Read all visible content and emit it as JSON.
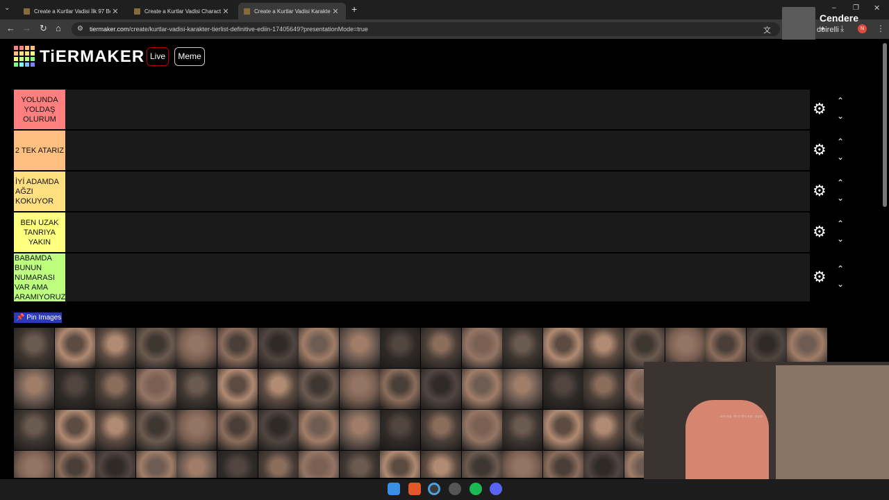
{
  "browser": {
    "tabs": [
      {
        "title": "Create a Kurtlar Vadisi İlk 97 Bö"
      },
      {
        "title": "Create a Kurtlar Vadisi Characte"
      },
      {
        "title": "Create a Kurtlar Vadisi Karakter"
      }
    ],
    "new_tab": "+",
    "url_host": "tiermaker.com",
    "url_path": "/create/kurtlar-vadisi-karakter-tierlist-definitive-ediin-17405649?presentationMode=true",
    "profile_badge": "N",
    "overlay_name": "Cendere",
    "overlay_sub": "doirelli"
  },
  "site": {
    "logo_text": "TiERMAKER",
    "live_button": "Live",
    "meme_button": "Meme"
  },
  "tiers": [
    {
      "label": "YOLUNDA YOLDAŞ OLURUM",
      "color": "#ff7f7f"
    },
    {
      "label": "2 TEK ATARIZ",
      "color": "#ffbf7f"
    },
    {
      "label": "İYİ ADAMDA AĞZI KOKUYOR",
      "color": "#ffdf7f"
    },
    {
      "label": "BEN UZAK TANRIYA YAKIN",
      "color": "#ffff7f"
    },
    {
      "label": "BABAMDA BUNUN NUMARASI VAR AMA ARAMIYORUZ",
      "color": "#bfff7f"
    }
  ],
  "pin_images": "Pin Images",
  "webcam": {
    "caption": "using droidcam app"
  }
}
